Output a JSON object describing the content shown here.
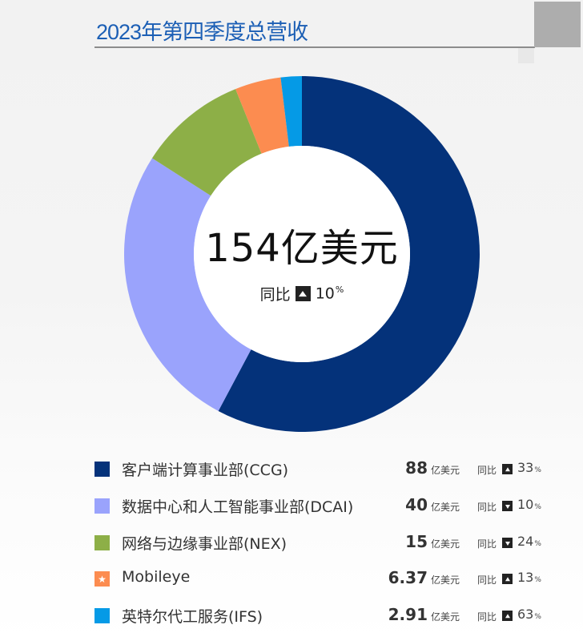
{
  "header": {
    "title": "2023年第四季度总营收"
  },
  "center": {
    "total": "154亿美元",
    "yoy_label": "同比",
    "yoy_direction": "up",
    "yoy_value": "10",
    "yoy_unit": "%"
  },
  "chart_data": {
    "type": "pie",
    "variant": "donut",
    "title": "2023年第四季度总营收",
    "unit": "亿美元",
    "total_label": "154亿美元",
    "start": "top",
    "direction": "clockwise",
    "categories": [
      "客户端计算事业部(CCG)",
      "数据中心和人工智能事业部(DCAI)",
      "网络与边缘事业部(NEX)",
      "Mobileye",
      "英特尔代工服务(IFS)"
    ],
    "values": [
      88,
      40,
      15,
      6.37,
      2.91
    ],
    "colors": [
      "#04327a",
      "#9aa3fc",
      "#8daf47",
      "#fc8c50",
      "#059ae6"
    ],
    "yoy": [
      {
        "direction": "up",
        "value": 33
      },
      {
        "direction": "down",
        "value": 10
      },
      {
        "direction": "down",
        "value": 24
      },
      {
        "direction": "up",
        "value": 13
      },
      {
        "direction": "up",
        "value": 63
      }
    ],
    "legend_position": "bottom"
  },
  "legend": {
    "unit": "亿美元",
    "yoy_label": "同比",
    "pct_unit": "%",
    "items": [
      {
        "label": "客户端计算事业部(CCG)",
        "value": "88",
        "direction": "up",
        "pct": "33",
        "color": "#04327a",
        "icon": "square"
      },
      {
        "label": "数据中心和人工智能事业部(DCAI)",
        "value": "40",
        "direction": "down",
        "pct": "10",
        "color": "#9aa3fc",
        "icon": "square"
      },
      {
        "label": "网络与边缘事业部(NEX)",
        "value": "15",
        "direction": "down",
        "pct": "24",
        "color": "#8daf47",
        "icon": "square"
      },
      {
        "label": "Mobileye",
        "value": "6.37",
        "direction": "up",
        "pct": "13",
        "color": "#fc8c50",
        "icon": "star-square"
      },
      {
        "label": "英特尔代工服务(IFS)",
        "value": "2.91",
        "direction": "up",
        "pct": "63",
        "color": "#059ae6",
        "icon": "square"
      }
    ]
  }
}
